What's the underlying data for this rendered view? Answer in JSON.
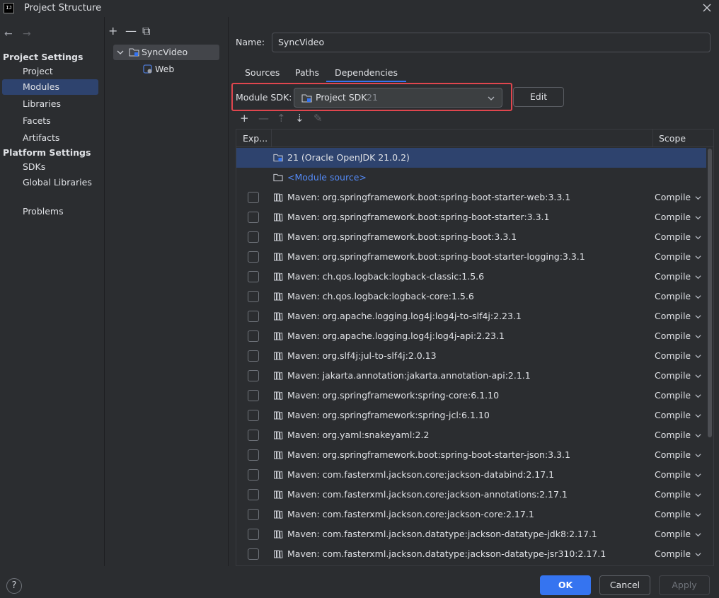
{
  "window": {
    "title": "Project Structure",
    "logo_text": "IJ"
  },
  "nav": {
    "project_settings_header": "Project Settings",
    "platform_settings_header": "Platform Settings",
    "items": {
      "project": "Project",
      "modules": "Modules",
      "libraries": "Libraries",
      "facets": "Facets",
      "artifacts": "Artifacts",
      "sdks": "SDKs",
      "global_libraries": "Global Libraries",
      "problems": "Problems"
    }
  },
  "tree": {
    "toolbar": {
      "add": "+",
      "remove": "—",
      "copy": "⧉"
    },
    "module": "SyncVideo",
    "facet": "Web"
  },
  "module": {
    "name_label": "Name:",
    "name_value": "SyncVideo",
    "tabs": [
      "Sources",
      "Paths",
      "Dependencies"
    ],
    "active_tab": "Dependencies",
    "sdk_label": "Module SDK:",
    "sdk_value": "Project SDK",
    "sdk_version": "21",
    "edit_label": "Edit"
  },
  "dependencies": {
    "columns": {
      "export": "Exp...",
      "scope": "Scope"
    },
    "sdk_row": "21 (Oracle OpenJDK 21.0.2)",
    "source_row": "<Module source>",
    "rows": [
      {
        "name": "Maven: org.springframework.boot:spring-boot-starter-web:3.3.1",
        "scope": "Compile"
      },
      {
        "name": "Maven: org.springframework.boot:spring-boot-starter:3.3.1",
        "scope": "Compile"
      },
      {
        "name": "Maven: org.springframework.boot:spring-boot:3.3.1",
        "scope": "Compile"
      },
      {
        "name": "Maven: org.springframework.boot:spring-boot-starter-logging:3.3.1",
        "scope": "Compile"
      },
      {
        "name": "Maven: ch.qos.logback:logback-classic:1.5.6",
        "scope": "Compile"
      },
      {
        "name": "Maven: ch.qos.logback:logback-core:1.5.6",
        "scope": "Compile"
      },
      {
        "name": "Maven: org.apache.logging.log4j:log4j-to-slf4j:2.23.1",
        "scope": "Compile"
      },
      {
        "name": "Maven: org.apache.logging.log4j:log4j-api:2.23.1",
        "scope": "Compile"
      },
      {
        "name": "Maven: org.slf4j:jul-to-slf4j:2.0.13",
        "scope": "Compile"
      },
      {
        "name": "Maven: jakarta.annotation:jakarta.annotation-api:2.1.1",
        "scope": "Compile"
      },
      {
        "name": "Maven: org.springframework:spring-core:6.1.10",
        "scope": "Compile"
      },
      {
        "name": "Maven: org.springframework:spring-jcl:6.1.10",
        "scope": "Compile"
      },
      {
        "name": "Maven: org.yaml:snakeyaml:2.2",
        "scope": "Compile"
      },
      {
        "name": "Maven: org.springframework.boot:spring-boot-starter-json:3.3.1",
        "scope": "Compile"
      },
      {
        "name": "Maven: com.fasterxml.jackson.core:jackson-databind:2.17.1",
        "scope": "Compile"
      },
      {
        "name": "Maven: com.fasterxml.jackson.core:jackson-annotations:2.17.1",
        "scope": "Compile"
      },
      {
        "name": "Maven: com.fasterxml.jackson.core:jackson-core:2.17.1",
        "scope": "Compile"
      },
      {
        "name": "Maven: com.fasterxml.jackson.datatype:jackson-datatype-jdk8:2.17.1",
        "scope": "Compile"
      },
      {
        "name": "Maven: com.fasterxml.jackson.datatype:jackson-datatype-jsr310:2.17.1",
        "scope": "Compile"
      }
    ]
  },
  "footer": {
    "help": "?",
    "ok": "OK",
    "cancel": "Cancel",
    "apply": "Apply"
  },
  "colors": {
    "accent": "#3574f0",
    "selection": "#2e436e",
    "highlight_border": "#e0464e",
    "background": "#2b2d30"
  }
}
